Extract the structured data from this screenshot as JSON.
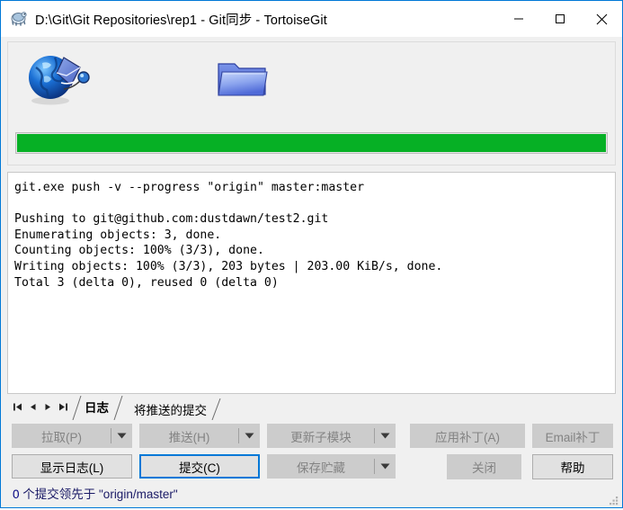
{
  "window": {
    "title": "D:\\Git\\Git Repositories\\rep1 - Git同步 - TortoiseGit",
    "app_icon": "tortoisegit-turtle-icon",
    "border_color": "#0078d7",
    "minimize_label": "最小化",
    "maximize_label": "最大化",
    "close_label": "关闭"
  },
  "top_panel": {
    "source_icon": "globe-network-icon",
    "target_icon": "folder-icon",
    "progress": {
      "percent": 100,
      "color": "#06b025"
    }
  },
  "log": {
    "text": "git.exe push -v --progress \"origin\" master:master\n\nPushing to git@github.com:dustdawn/test2.git\nEnumerating objects: 3, done.\nCounting objects: 100% (3/3), done.\nWriting objects: 100% (3/3), 203 bytes | 203.00 KiB/s, done.\nTotal 3 (delta 0), reused 0 (delta 0)"
  },
  "tabstrip": {
    "nav": [
      {
        "name": "first",
        "glyph": "◀▏"
      },
      {
        "name": "prev",
        "glyph": "◀"
      },
      {
        "name": "next",
        "glyph": "▶"
      },
      {
        "name": "last",
        "glyph": "▕▶"
      }
    ],
    "tabs": [
      {
        "label": "日志",
        "active": true
      },
      {
        "label": "将推送的提交",
        "active": false
      }
    ]
  },
  "buttons": {
    "pull": {
      "label": "拉取(P)",
      "enabled": false,
      "has_dropdown": true
    },
    "push": {
      "label": "推送(H)",
      "enabled": false,
      "has_dropdown": true
    },
    "update_submodule": {
      "label": "更新子模块",
      "enabled": false,
      "has_dropdown": true
    },
    "apply_patch": {
      "label": "应用补丁(A)",
      "enabled": false,
      "has_dropdown": false
    },
    "email_patch": {
      "label": "Email补丁",
      "enabled": false,
      "has_dropdown": false
    },
    "show_log": {
      "label": "显示日志(L)",
      "enabled": true,
      "has_dropdown": false
    },
    "commit": {
      "label": "提交(C)",
      "enabled": true,
      "is_default": true,
      "has_dropdown": false
    },
    "save_stash": {
      "label": "保存贮藏",
      "enabled": false,
      "has_dropdown": true
    },
    "close": {
      "label": "关闭",
      "enabled": false,
      "has_dropdown": false
    },
    "help": {
      "label": "帮助",
      "enabled": true,
      "has_dropdown": false
    }
  },
  "status": {
    "count": "0",
    "text": " 个提交领先于 \"origin/master\""
  }
}
